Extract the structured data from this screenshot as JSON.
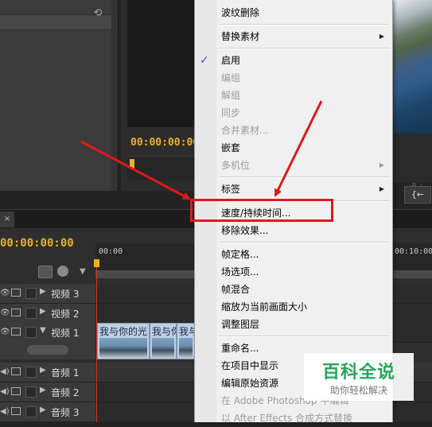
{
  "program": {
    "timecode": "00:00:00:00"
  },
  "right_panel": {
    "button_icon": "{←"
  },
  "timeline": {
    "sequence_timecode": "00:00:00:00",
    "ruler_start": "00:00",
    "ruler_end": "00:10:00",
    "tracks": [
      {
        "name": "视频 3"
      },
      {
        "name": "视频 2"
      },
      {
        "name": "视频 1"
      },
      {
        "name": "音频 1"
      },
      {
        "name": "音频 2"
      },
      {
        "name": "音频 3"
      }
    ],
    "clips": [
      {
        "title": "我与你的光"
      },
      {
        "title": "我与你"
      },
      {
        "title": "我与"
      }
    ]
  },
  "context_menu": {
    "items": [
      {
        "label": "波纹删除",
        "enabled": true
      },
      {
        "label": "替换素材",
        "enabled": true,
        "submenu": true
      },
      {
        "label": "启用",
        "enabled": true,
        "checked": true
      },
      {
        "label": "编组",
        "enabled": false
      },
      {
        "label": "解组",
        "enabled": false
      },
      {
        "label": "同步",
        "enabled": false
      },
      {
        "label": "合并素材...",
        "enabled": false
      },
      {
        "label": "嵌套",
        "enabled": true
      },
      {
        "label": "多机位",
        "enabled": false,
        "submenu": true
      },
      {
        "label": "标签",
        "enabled": true,
        "submenu": true
      },
      {
        "label": "速度/持续时间...",
        "enabled": true,
        "highlighted": true
      },
      {
        "label": "移除效果...",
        "enabled": true
      },
      {
        "label": "帧定格...",
        "enabled": true
      },
      {
        "label": "场选项...",
        "enabled": true
      },
      {
        "label": "帧混合",
        "enabled": true
      },
      {
        "label": "缩放为当前画面大小",
        "enabled": true
      },
      {
        "label": "调整图层",
        "enabled": true
      },
      {
        "label": "重命名...",
        "enabled": true
      },
      {
        "label": "在项目中显示",
        "enabled": true
      },
      {
        "label": "编辑原始资源",
        "enabled": true
      },
      {
        "label": "在 Adobe Photoshop 中编辑",
        "enabled": false
      },
      {
        "label": "以 After Effects 合成方式替换",
        "enabled": false
      }
    ]
  },
  "watermark": {
    "title": "百科全说",
    "subtitle": "助你轻松解决"
  },
  "colors": {
    "timecode": "#e8b224",
    "annotation_red": "#e0181a",
    "menu_bg": "#f0f0f0"
  }
}
